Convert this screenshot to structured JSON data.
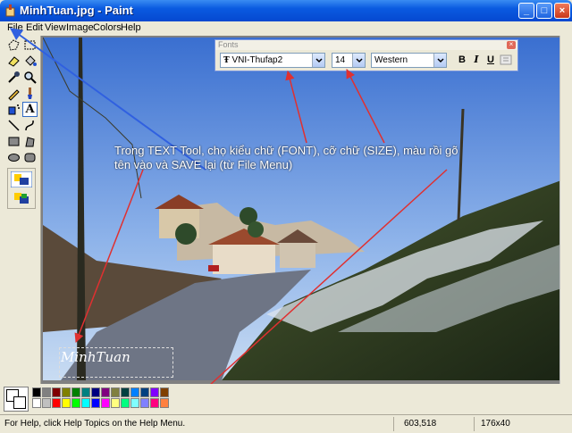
{
  "window": {
    "title": "MinhTuan.jpg - Paint",
    "minimize": "_",
    "maximize": "□",
    "close": "×"
  },
  "menu": [
    "File",
    "Edit",
    "View",
    "Image",
    "Colors",
    "Help"
  ],
  "fonts_toolbar": {
    "title": "Fonts",
    "close": "×",
    "font_name": "VNI-Thufap2",
    "font_size": "14",
    "script": "Western",
    "bold": "B",
    "italic": "I",
    "underline": "U"
  },
  "annotation": {
    "instruction": "Trong TEXT Tool, chọ kiểu chữ (FONT), cỡ chữ (SIZE), màu rồi gõ tên vào và SAVE lại (từ File Menu)",
    "color": "#e03030"
  },
  "canvas": {
    "typed_text": "MinhTuan"
  },
  "palette": [
    "#000000",
    "#808080",
    "#800000",
    "#808000",
    "#008000",
    "#008080",
    "#000080",
    "#800080",
    "#808040",
    "#004040",
    "#0080ff",
    "#004080",
    "#8000ff",
    "#804000",
    "#ffffff",
    "#c0c0c0",
    "#ff0000",
    "#ffff00",
    "#00ff00",
    "#00ffff",
    "#0000ff",
    "#ff00ff",
    "#ffff80",
    "#00ff80",
    "#80ffff",
    "#8080ff",
    "#ff0080",
    "#ff8040"
  ],
  "status": {
    "help": "For Help, click Help Topics on the Help Menu.",
    "coords": "603,518",
    "size": "176x40"
  }
}
